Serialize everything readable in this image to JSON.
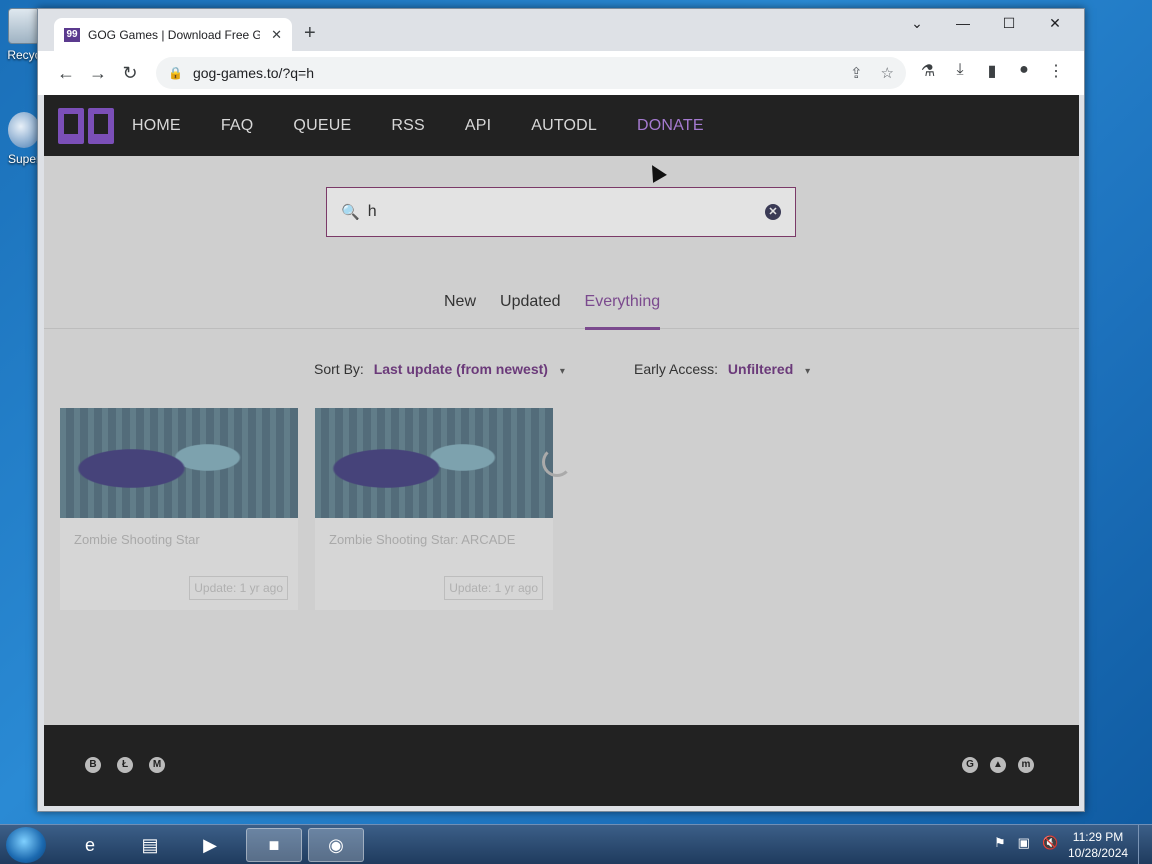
{
  "desktop": {
    "icons": [
      {
        "label": "Recyc"
      },
      {
        "label": "Super"
      }
    ]
  },
  "browser": {
    "tab_title": "GOG Games | Download Free GOG",
    "favicon_text": "99",
    "url": "gog-games.to/?q=h"
  },
  "site": {
    "nav": [
      "HOME",
      "FAQ",
      "QUEUE",
      "RSS",
      "API",
      "AUTODL",
      "DONATE"
    ],
    "search_value": "h",
    "tabs": [
      "New",
      "Updated",
      "Everything"
    ],
    "active_tab": "Everything",
    "sort_label": "Sort By:",
    "sort_value": "Last update (from newest)",
    "early_access_label": "Early Access:",
    "early_access_value": "Unfiltered",
    "results": [
      {
        "title": "Zombie Shooting Star",
        "badge": "Update: 1 yr ago"
      },
      {
        "title": "Zombie Shooting Star: ARCADE",
        "badge": "Update: 1 yr ago"
      }
    ]
  },
  "taskbar": {
    "time": "11:29 PM",
    "date": "10/28/2024"
  },
  "colors": {
    "accent": "#7b4a8e",
    "nav_bg": "#222222",
    "page_overlay": "#cfcfcf"
  }
}
